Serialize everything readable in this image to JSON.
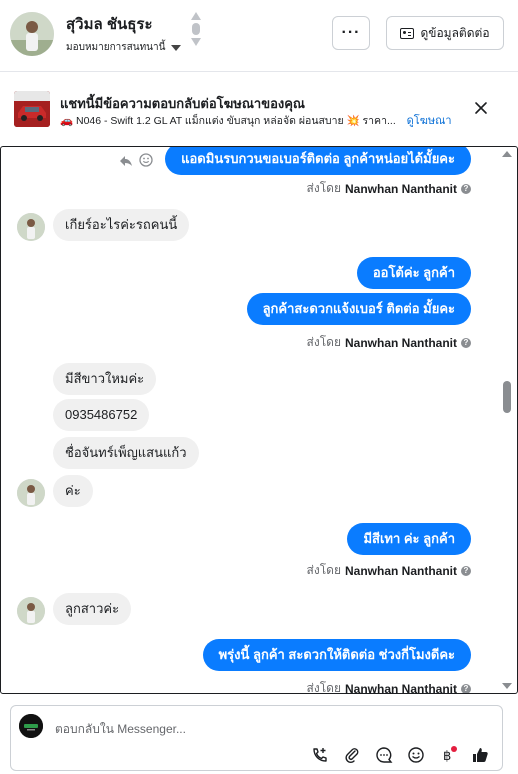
{
  "header": {
    "contact_name": "สุวิมล ชันธุระ",
    "assign_label": "มอบหมายการสนทนานี้",
    "more_label": "···",
    "contact_info_label": "ดูข้อมูลติดต่อ"
  },
  "ad_banner": {
    "title": "แชทนี้มีข้อความตอบกลับต่อโฆษณาของคุณ",
    "subtitle": "🚗 N046 - Swift 1.2 GL AT แม็กแต่ง ขับสนุก หล่อจัด ผ่อนสบาย 💥 ราคา...",
    "link_label": "ดูโฆษณา"
  },
  "messages": [
    {
      "type": "out",
      "text": "แอดมินรบกวนขอเบอร์ติดต่อ ลูกค้าหน่อยได้มั้ยคะ"
    },
    {
      "type": "sent_by",
      "prefix": "ส่งโดย",
      "name": "Nanwhan Nanthanit"
    },
    {
      "type": "in",
      "text": "เกียร์อะไรค่ะรถคนนี้"
    },
    {
      "type": "out",
      "text": "ออโต้ค่ะ  ลูกค้า"
    },
    {
      "type": "out",
      "text": "ลูกค้าสะดวกแจ้งเบอร์ ติดต่อ มั้ยคะ"
    },
    {
      "type": "sent_by",
      "prefix": "ส่งโดย",
      "name": "Nanwhan Nanthanit"
    },
    {
      "type": "in",
      "text": "มีสีขาวใหมค่ะ"
    },
    {
      "type": "in",
      "text": "0935486752"
    },
    {
      "type": "in",
      "text": "ชื่อจันทร์เพ็ญแสนแก้ว"
    },
    {
      "type": "in",
      "text": "ค่ะ"
    },
    {
      "type": "out",
      "text": "มีสีเทา ค่ะ  ลูกค้า"
    },
    {
      "type": "sent_by",
      "prefix": "ส่งโดย",
      "name": "Nanwhan Nanthanit"
    },
    {
      "type": "in",
      "text": "ลูกสาวค่ะ"
    },
    {
      "type": "out",
      "text": "พรุ่งนี้ ลูกค้า สะดวกให้ติดต่อ ช่วงกี่โมงดีคะ"
    },
    {
      "type": "sent_by",
      "prefix": "ส่งโดย",
      "name": "Nanwhan Nanthanit"
    }
  ],
  "reply": {
    "placeholder": "ตอบกลับใน Messenger..."
  },
  "colors": {
    "outgoing_bubble": "#0a7cff",
    "incoming_bubble": "#f0f0f0",
    "link": "#0a6fd6"
  }
}
